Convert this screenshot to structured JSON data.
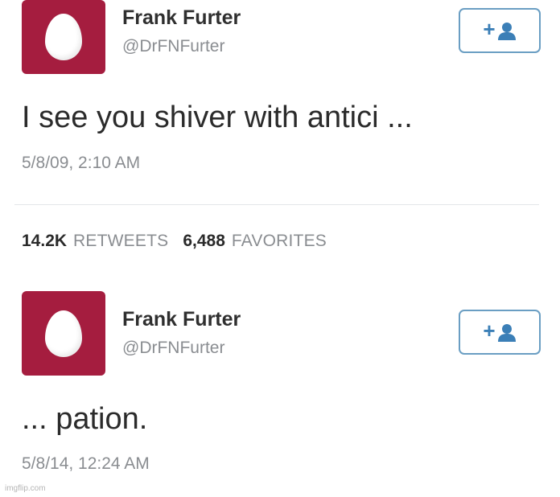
{
  "colors": {
    "avatar_bg": "#a51d3f",
    "follow_border": "#6a9ec3",
    "follow_icon": "#3b7fb7",
    "muted_text": "#8a8d91"
  },
  "tweets": [
    {
      "name": "Frank Furter",
      "handle": "@DrFNFurter",
      "text": "I see you shiver with antici ...",
      "timestamp": "5/8/09, 2:10 AM",
      "avatar_icon": "egg-icon",
      "follow_icon": "add-user-icon"
    },
    {
      "name": "Frank Furter",
      "handle": "@DrFNFurter",
      "text": "... pation.",
      "timestamp": "5/8/14, 12:24 AM",
      "avatar_icon": "egg-icon",
      "follow_icon": "add-user-icon"
    }
  ],
  "stats": {
    "retweets_count": "14.2K",
    "retweets_label": "RETWEETS",
    "favorites_count": "6,488",
    "favorites_label": "FAVORITES"
  },
  "watermark": "imgflip.com"
}
